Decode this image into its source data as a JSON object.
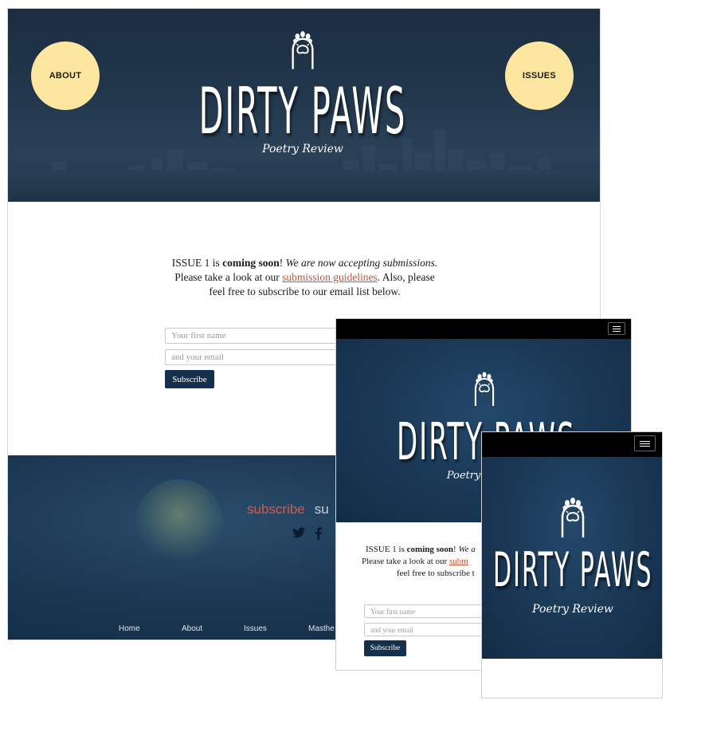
{
  "brand": {
    "title": "DIRTY PAWS",
    "subtitle": "Poetry Review"
  },
  "nav": {
    "about": "ABOUT",
    "issues": "ISSUES"
  },
  "intro": {
    "l1_a": "ISSUE 1 is ",
    "l1_b": "coming soon",
    "l1_c": "! ",
    "l1_d": "We are now accepting submissions.",
    "l2_a": "Please take a look at our ",
    "l2_link": "submission guidelines",
    "l2_c": ". Also, please",
    "l3": "feel free to subscribe to our email list below."
  },
  "tablet_intro": {
    "l1_d": "We a",
    "l2_link": "subm",
    "l3": "feel free to subscribe t"
  },
  "form": {
    "first_name_placeholder": "Your first name",
    "email_placeholder": "and your email",
    "subscribe_button": "Subscribe"
  },
  "footer": {
    "subscribe_word": "subscribe",
    "second_word": "su",
    "nav": [
      "Home",
      "About",
      "Issues",
      "Masthe"
    ]
  },
  "colors": {
    "hero_navy": "#1e3347",
    "circle_yellow": "#fde7a0",
    "link": "#c0553a",
    "button": "#15304d",
    "footer_subscribe": "#d8574a"
  },
  "icons": [
    "paw-icon",
    "twitter-icon",
    "facebook-icon",
    "hamburger-menu-icon"
  ]
}
